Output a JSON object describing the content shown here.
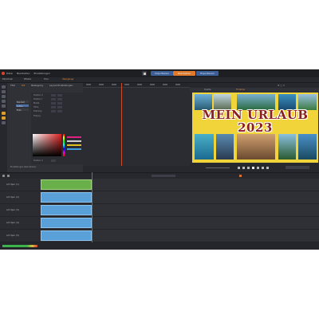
{
  "app": {
    "menu": [
      "Datei",
      "Bearbeiten",
      "Einstellungen"
    ],
    "top_tabs": [
      "Importieren",
      "Bearbeiten",
      "Exportieren"
    ],
    "active_top_tab": "Bearbeiten"
  },
  "toolbar2": {
    "items": [
      "Bibliothek",
      "Effekte",
      "Titel",
      "Übergänge"
    ]
  },
  "editor": {
    "tabs": [
      "Titel",
      "Stil",
      "Bewegung",
      "Layout-Einstellungen"
    ],
    "active_tab": "Stil",
    "side_items": [
      "Standard",
      "Aufbau",
      "Ende",
      "Farben",
      "Text"
    ],
    "props": [
      {
        "label": "Position X",
        "v1": "0",
        "v2": "0"
      },
      {
        "label": "Position Y",
        "v1": "0",
        "v2": "0"
      },
      {
        "label": "Breite",
        "v1": "0",
        "v2": "0"
      },
      {
        "label": "Höhe",
        "v1": "0",
        "v2": "0"
      },
      {
        "label": "Drehung",
        "v1": "0",
        "v2": "0"
      },
      {
        "label": "Füllung",
        "v1": "",
        "v2": ""
      }
    ],
    "props2": [
      {
        "label": "Position X",
        "v1": "0"
      },
      {
        "label": "Position Y",
        "v1": "0"
      },
      {
        "label": "Breite",
        "v1": "0"
      },
      {
        "label": "Höhe",
        "v1": "0"
      },
      {
        "label": "Drehung",
        "v1": "0"
      }
    ],
    "footer_label": "Einstellungen übernehmen"
  },
  "preview": {
    "tabs": [
      "Quelle",
      "Timeline"
    ],
    "active_tab": "Timeline",
    "title_line1": "MEIN URLAUB",
    "title_line2": "2023",
    "accent": "#f0d43a",
    "title_color": "#8a1f1f"
  },
  "timeline": {
    "tracks": [
      {
        "name": "A/V Spur (1)"
      },
      {
        "name": "A/V Spur (2)"
      },
      {
        "name": "A/V Spur (3)"
      },
      {
        "name": "A/V Spur (4)"
      },
      {
        "name": "A/V Spur (5)"
      }
    ],
    "status_left": "Projekt 01"
  },
  "colors": {
    "accent_orange": "#e07a2a",
    "accent_blue": "#3a5f99",
    "clip_blue": "#5aa0d8",
    "playhead": "#c94b2a"
  }
}
